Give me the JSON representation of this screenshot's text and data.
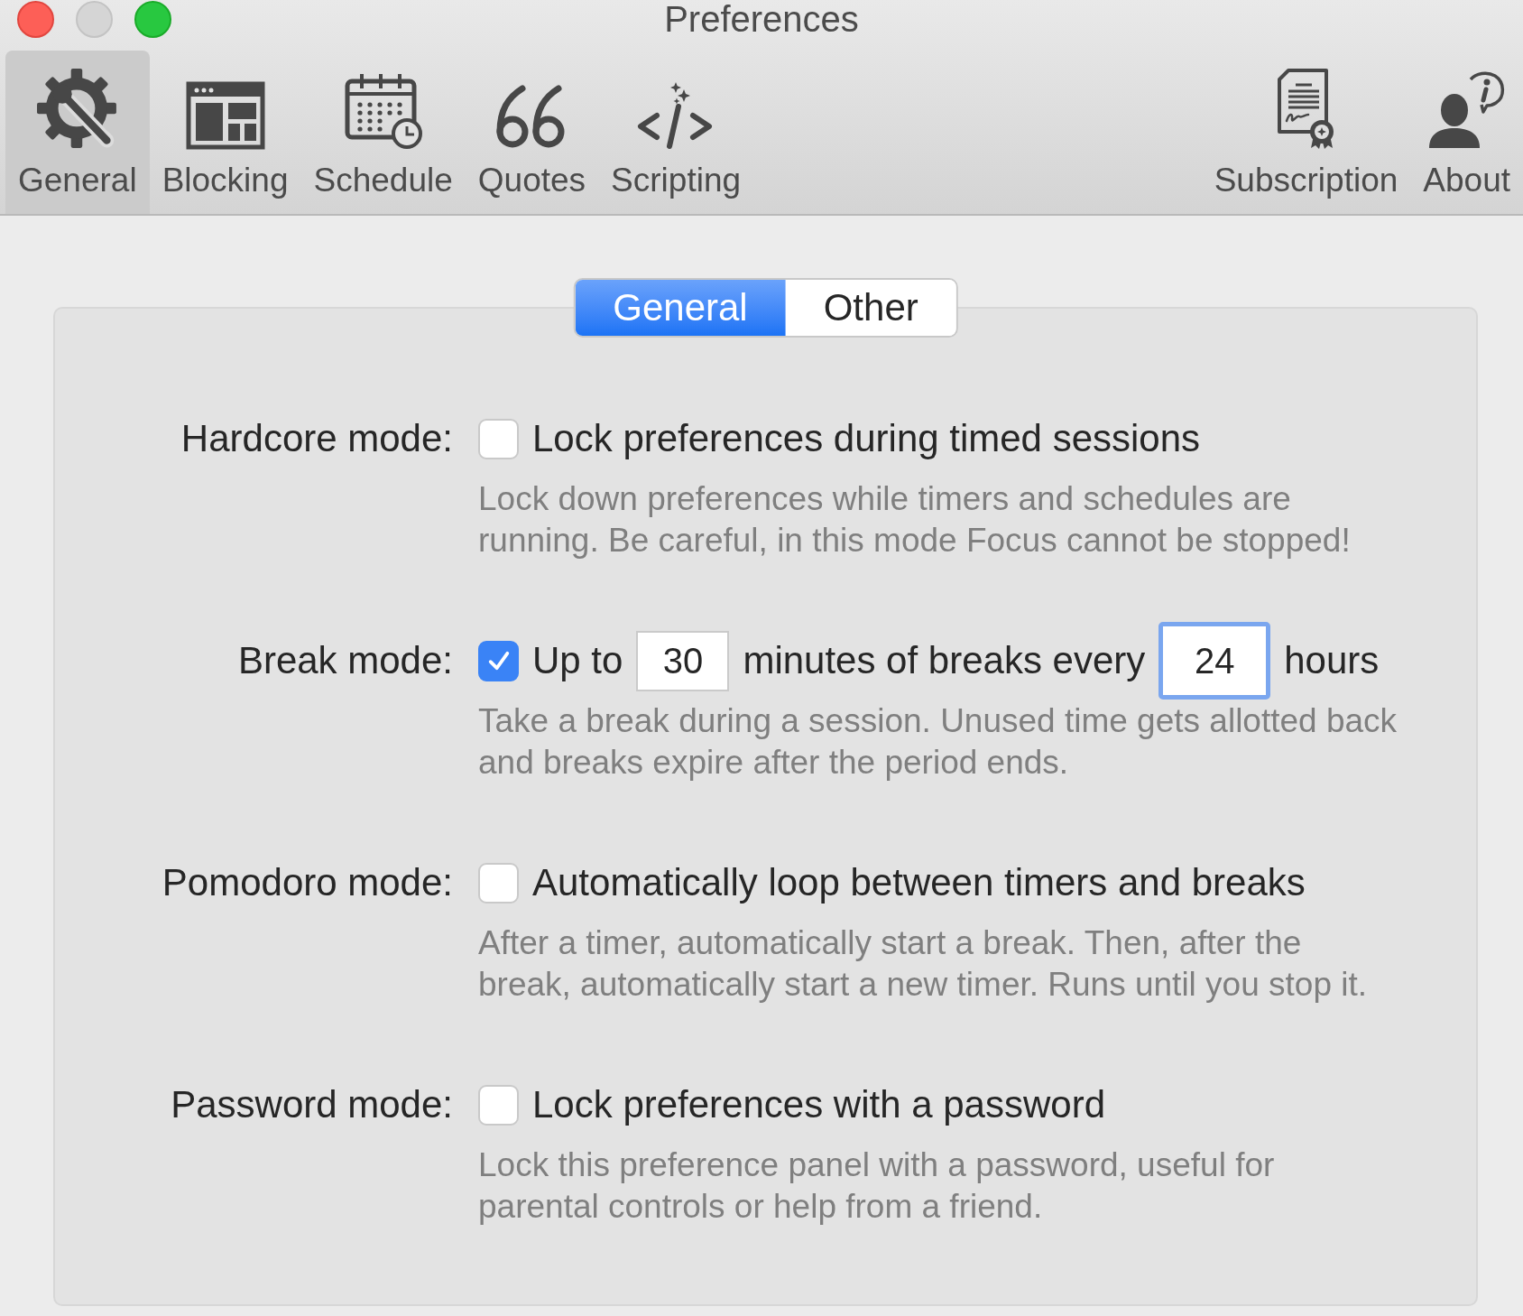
{
  "window": {
    "title": "Preferences",
    "controls": [
      {
        "kind": "close",
        "disabled": false
      },
      {
        "kind": "minimize",
        "disabled": true
      },
      {
        "kind": "zoom",
        "disabled": false
      }
    ]
  },
  "toolbar": {
    "left_items": [
      {
        "label": "General",
        "selected": true
      },
      {
        "label": "Blocking",
        "selected": false
      },
      {
        "label": "Schedule",
        "selected": false
      },
      {
        "label": "Quotes",
        "selected": false
      },
      {
        "label": "Scripting",
        "selected": false
      }
    ],
    "right_items": [
      {
        "label": "Subscription",
        "selected": false
      },
      {
        "label": "About",
        "selected": false
      }
    ]
  },
  "tabs": [
    {
      "label": "General",
      "selected": true
    },
    {
      "label": "Other",
      "selected": false
    }
  ],
  "settings": [
    {
      "label": "Hardcore mode:",
      "checked": false,
      "option": [
        {
          "kind": "text",
          "text": "Lock preferences during timed sessions"
        }
      ],
      "description": [
        "Lock down preferences while timers and schedules are",
        "running. Be careful, in this mode Focus cannot be stopped!"
      ]
    },
    {
      "label": "Break mode:",
      "checked": true,
      "option": [
        {
          "kind": "text",
          "text": "Up to"
        },
        {
          "kind": "field",
          "value": "30",
          "focused": false
        },
        {
          "kind": "text",
          "text": "minutes of breaks every"
        },
        {
          "kind": "field",
          "value": "24",
          "focused": true
        },
        {
          "kind": "text",
          "text": "hours"
        }
      ],
      "description": [
        "Take a break during a session. Unused time gets allotted back",
        "and breaks expire after the period ends."
      ]
    },
    {
      "label": "Pomodoro mode:",
      "checked": false,
      "option": [
        {
          "kind": "text",
          "text": "Automatically loop between timers and breaks"
        }
      ],
      "description": [
        "After a timer, automatically start a break. Then, after the",
        "break, automatically start a new timer. Runs until you stop it."
      ]
    },
    {
      "label": "Password mode:",
      "checked": false,
      "option": [
        {
          "kind": "text",
          "text": "Lock preferences with a password"
        }
      ],
      "description": [
        "Lock this preference panel with a password, useful for",
        "parental controls or help from a friend."
      ]
    }
  ]
}
